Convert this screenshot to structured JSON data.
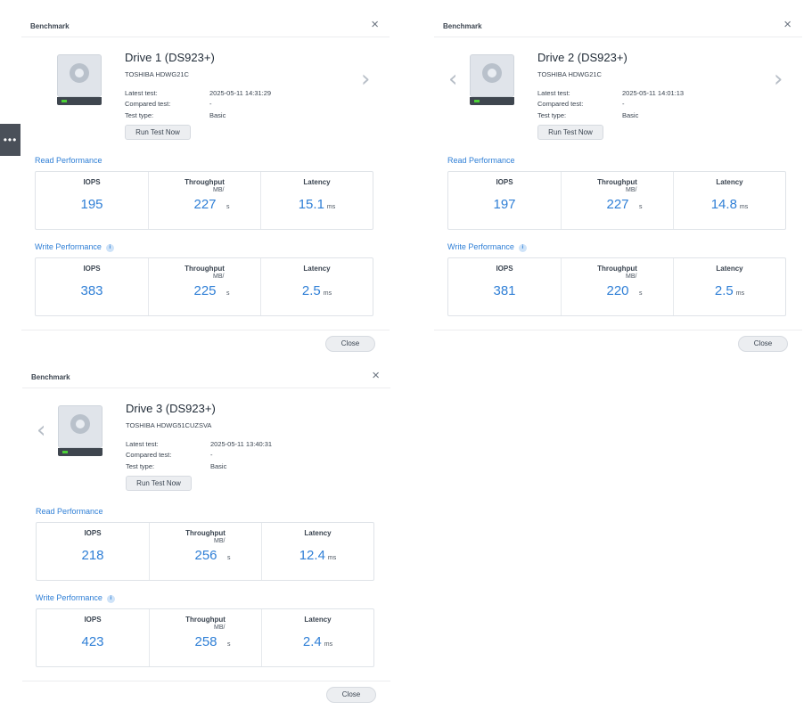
{
  "side_tab": {
    "label": "•••"
  },
  "panels": [
    {
      "title": "Benchmark",
      "close_symbol": "×",
      "drive_name": "Drive 1 (DS923+)",
      "model": "TOSHIBA HDWG21C",
      "latest_label": "Latest test:",
      "latest_value": "2025-05-11 14:31:29",
      "compared_label": "Compared test:",
      "compared_value": "-",
      "type_label": "Test type:",
      "type_value": "Basic",
      "run_button": "Run Test Now",
      "read_label": "Read Performance",
      "write_label": "Write Performance",
      "info_icon": "i",
      "headers": {
        "iops": "IOPS",
        "throughput": "Throughput",
        "latency": "Latency"
      },
      "units": {
        "mb": "MB/",
        "s": "s",
        "ms": "ms"
      },
      "read": {
        "iops": "195",
        "throughput": "227",
        "latency": "15.1"
      },
      "write": {
        "iops": "383",
        "throughput": "225",
        "latency": "2.5"
      },
      "close_button": "Close",
      "nav": "right"
    },
    {
      "title": "Benchmark",
      "close_symbol": "×",
      "drive_name": "Drive 2 (DS923+)",
      "model": "TOSHIBA HDWG21C",
      "latest_label": "Latest test:",
      "latest_value": "2025-05-11 14:01:13",
      "compared_label": "Compared test:",
      "compared_value": "-",
      "type_label": "Test type:",
      "type_value": "Basic",
      "run_button": "Run Test Now",
      "read_label": "Read Performance",
      "write_label": "Write Performance",
      "info_icon": "i",
      "headers": {
        "iops": "IOPS",
        "throughput": "Throughput",
        "latency": "Latency"
      },
      "units": {
        "mb": "MB/",
        "s": "s",
        "ms": "ms"
      },
      "read": {
        "iops": "197",
        "throughput": "227",
        "latency": "14.8"
      },
      "write": {
        "iops": "381",
        "throughput": "220",
        "latency": "2.5"
      },
      "close_button": "Close",
      "nav": "both"
    },
    {
      "title": "Benchmark",
      "close_symbol": "×",
      "drive_name": "Drive 3 (DS923+)",
      "model": "TOSHIBA HDWG51CUZSVA",
      "latest_label": "Latest test:",
      "latest_value": "2025-05-11 13:40:31",
      "compared_label": "Compared test:",
      "compared_value": "-",
      "type_label": "Test type:",
      "type_value": "Basic",
      "run_button": "Run Test Now",
      "read_label": "Read Performance",
      "write_label": "Write Performance",
      "info_icon": "i",
      "headers": {
        "iops": "IOPS",
        "throughput": "Throughput",
        "latency": "Latency"
      },
      "units": {
        "mb": "MB/",
        "s": "s",
        "ms": "ms"
      },
      "read": {
        "iops": "218",
        "throughput": "256",
        "latency": "12.4"
      },
      "write": {
        "iops": "423",
        "throughput": "258",
        "latency": "2.4"
      },
      "close_button": "Close",
      "nav": "left"
    }
  ],
  "chevrons": {
    "left": "‹",
    "right": "›"
  }
}
